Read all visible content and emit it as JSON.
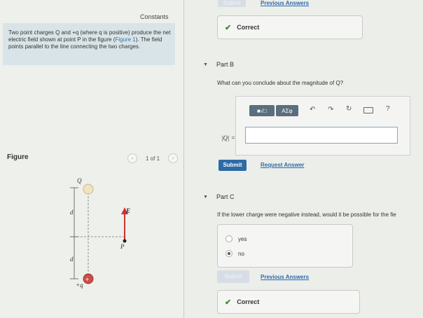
{
  "left": {
    "constants_label": "Constants",
    "problem_text_1": "Two point charges Q and +q (where q is positive) produce the net electric field shown at point P in the figure (",
    "figure_link": "Figure 1",
    "problem_text_2": "). The field points parallel to the line connecting the two charges.",
    "figure_heading": "Figure",
    "pager_text": "1 of 1",
    "figure": {
      "label_Q": "Q",
      "label_d_top": "d",
      "label_E": "E",
      "label_P": "P",
      "label_d_bottom": "d",
      "label_plus_q": "+q"
    }
  },
  "right": {
    "top_submit_label": "Submit",
    "top_previous_answers": "Previous Answers",
    "part_a_feedback": "Correct",
    "part_b": {
      "title": "Part B",
      "question": "What can you conclude about the magnitude of Q?",
      "toolbar": {
        "templates_label": "■√□",
        "greek_label": "ΑΣφ",
        "help_label": "?"
      },
      "answer_label": "|Q| =",
      "answer_value": "",
      "submit_label": "Submit",
      "request_answer_label": "Request Answer"
    },
    "part_c": {
      "title": "Part C",
      "question": "If the lower charge were negative instead, would it be possible for the fie",
      "options": [
        "yes",
        "no"
      ],
      "selected": "no",
      "submit_label": "Submit",
      "previous_answers_label": "Previous Answers",
      "feedback": "Correct"
    }
  }
}
